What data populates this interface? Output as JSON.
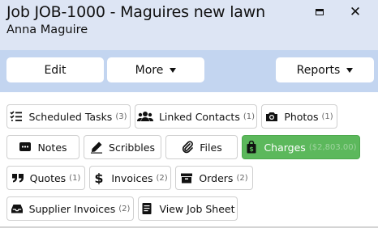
{
  "window": {
    "title": "Job JOB-1000 - Maguires new lawn",
    "subtitle": "Anna Maguire",
    "maximize_icon": "maximize-icon",
    "close_icon": "close-icon"
  },
  "toolbar": {
    "edit_label": "Edit",
    "more_label": "More",
    "reports_label": "Reports"
  },
  "tiles": {
    "scheduled_tasks": {
      "label": "Scheduled Tasks",
      "count": "(3)",
      "icon": "task-list-icon"
    },
    "linked_contacts": {
      "label": "Linked Contacts",
      "count": "(1)",
      "icon": "users-icon"
    },
    "photos": {
      "label": "Photos",
      "count": "(1)",
      "icon": "camera-icon"
    },
    "notes": {
      "label": "Notes",
      "icon": "message-icon"
    },
    "scribbles": {
      "label": "Scribbles",
      "icon": "pencil-icon"
    },
    "files": {
      "label": "Files",
      "icon": "paperclip-icon"
    },
    "charges": {
      "label": "Charges",
      "count": "($2,803.00)",
      "icon": "shopping-bag-icon",
      "color": "#5cb85c"
    },
    "quotes": {
      "label": "Quotes",
      "count": "(1)",
      "icon": "quote-icon"
    },
    "invoices": {
      "label": "Invoices",
      "count": "(2)",
      "icon": "dollar-icon"
    },
    "orders": {
      "label": "Orders",
      "count": "(2)",
      "icon": "box-icon"
    },
    "supplier_invoices": {
      "label": "Supplier Invoices",
      "count": "(2)",
      "icon": "inbox-icon"
    },
    "view_job_sheet": {
      "label": "View Job Sheet",
      "icon": "document-icon"
    }
  },
  "colors": {
    "header_bg": "#dde5f4",
    "toolbar_bg": "#c3d5f0",
    "accent_green": "#5cb85c"
  }
}
